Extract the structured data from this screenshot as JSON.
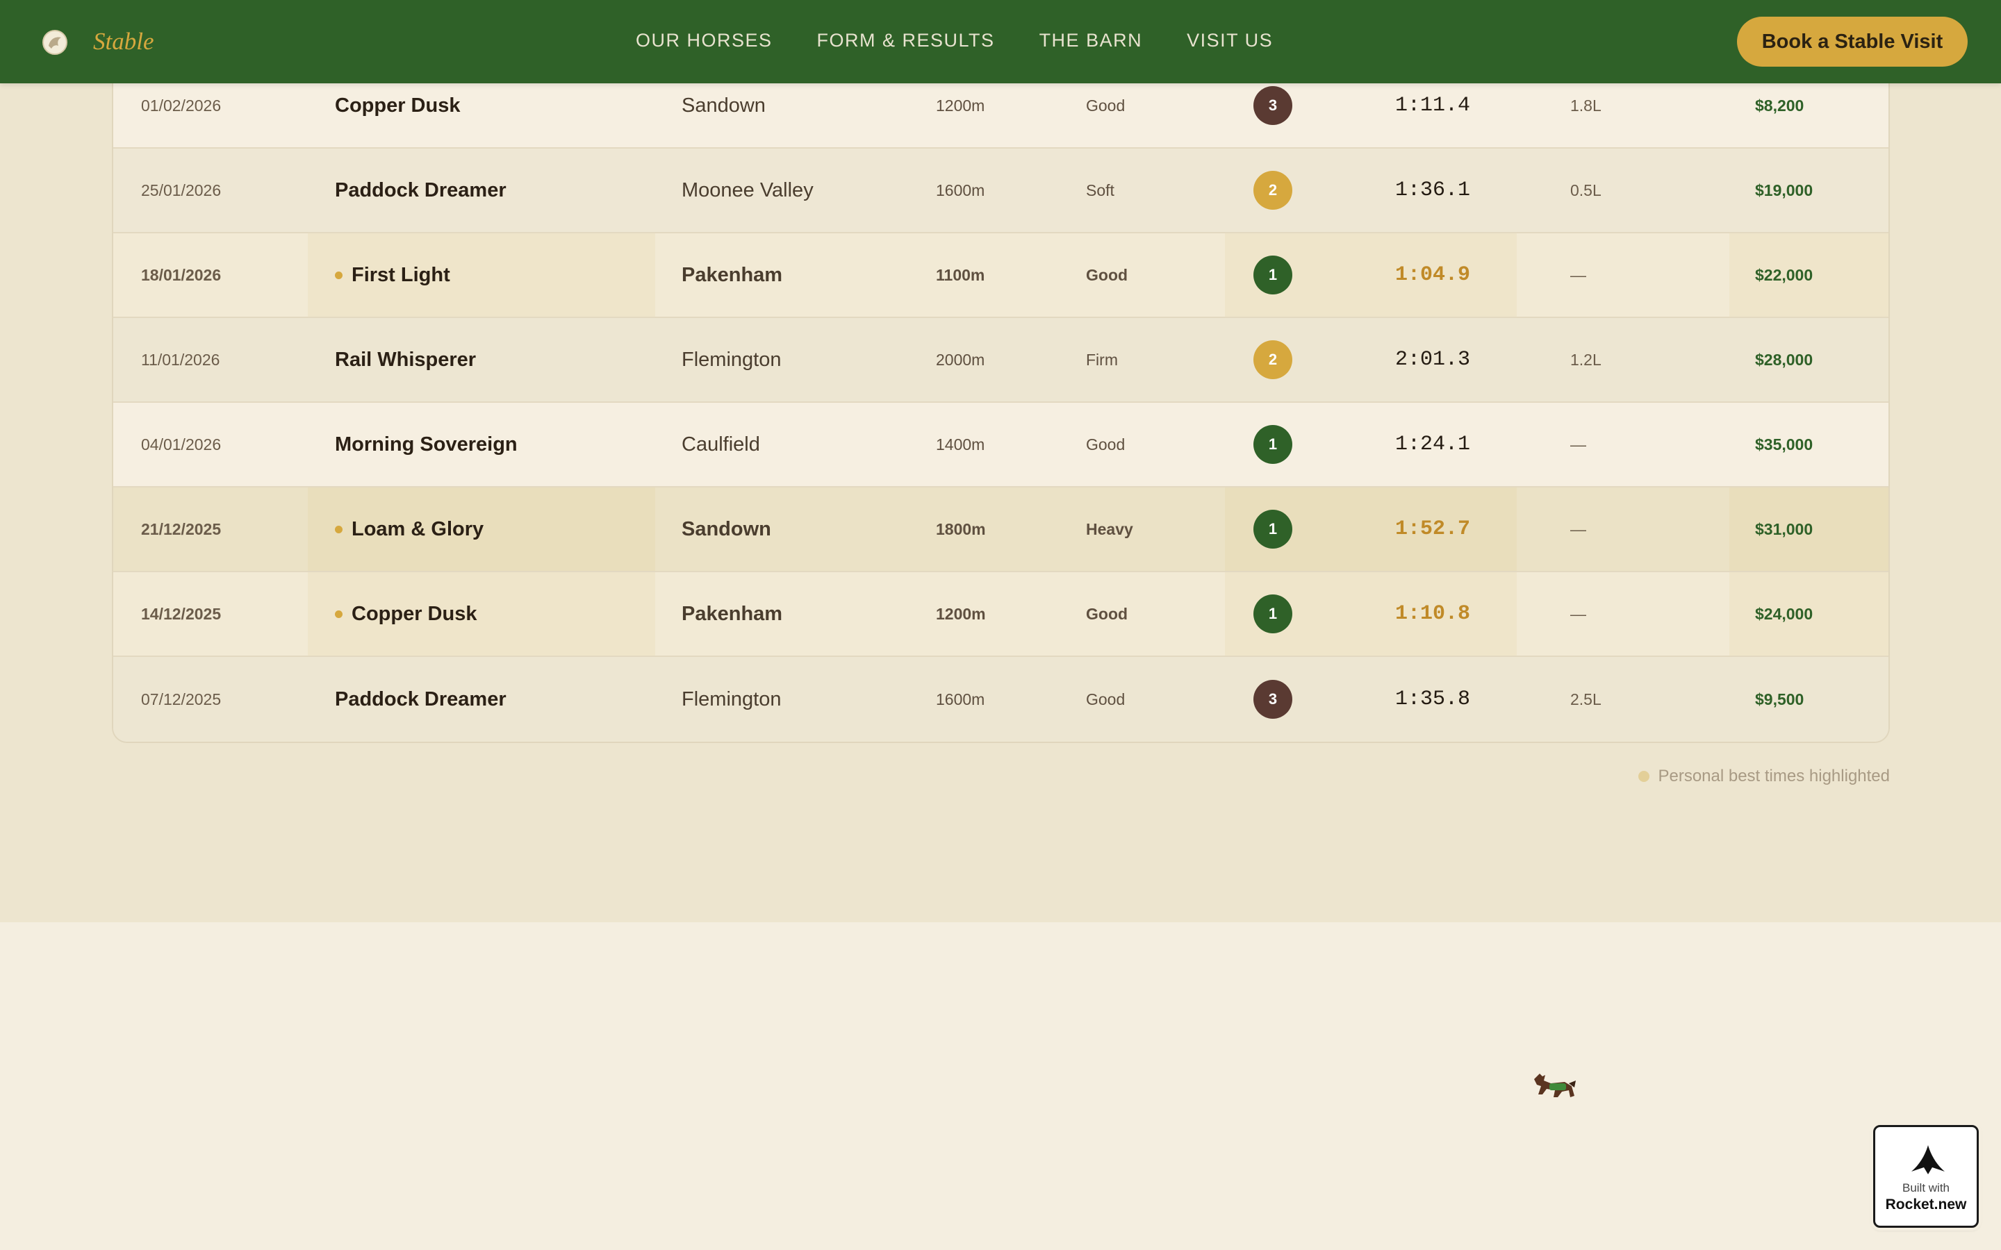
{
  "nav": {
    "brand": "Stable",
    "links": [
      "OUR HORSES",
      "FORM & RESULTS",
      "THE BARN",
      "VISIT US"
    ],
    "cta_label": "Book a Stable Visit"
  },
  "results": [
    {
      "date": "01/02/2026",
      "horse": "Copper Dusk",
      "track": "Sandown",
      "distance": "1200m",
      "going": "Good",
      "position": "3",
      "time": "1:11.4",
      "margin": "1.8L",
      "prize": "$8,200",
      "pb": false
    },
    {
      "date": "25/01/2026",
      "horse": "Paddock Dreamer",
      "track": "Moonee Valley",
      "distance": "1600m",
      "going": "Soft",
      "position": "2",
      "time": "1:36.1",
      "margin": "0.5L",
      "prize": "$19,000",
      "pb": false
    },
    {
      "date": "18/01/2026",
      "horse": "First Light",
      "track": "Pakenham",
      "distance": "1100m",
      "going": "Good",
      "position": "1",
      "time": "1:04.9",
      "margin": "—",
      "prize": "$22,000",
      "pb": true
    },
    {
      "date": "11/01/2026",
      "horse": "Rail Whisperer",
      "track": "Flemington",
      "distance": "2000m",
      "going": "Firm",
      "position": "2",
      "time": "2:01.3",
      "margin": "1.2L",
      "prize": "$28,000",
      "pb": false
    },
    {
      "date": "04/01/2026",
      "horse": "Morning Sovereign",
      "track": "Caulfield",
      "distance": "1400m",
      "going": "Good",
      "position": "1",
      "time": "1:24.1",
      "margin": "—",
      "prize": "$35,000",
      "pb": false
    },
    {
      "date": "21/12/2025",
      "horse": "Loam & Glory",
      "track": "Sandown",
      "distance": "1800m",
      "going": "Heavy",
      "position": "1",
      "time": "1:52.7",
      "margin": "—",
      "prize": "$31,000",
      "pb": true
    },
    {
      "date": "14/12/2025",
      "horse": "Copper Dusk",
      "track": "Pakenham",
      "distance": "1200m",
      "going": "Good",
      "position": "1",
      "time": "1:10.8",
      "margin": "—",
      "prize": "$24,000",
      "pb": true
    },
    {
      "date": "07/12/2025",
      "horse": "Paddock Dreamer",
      "track": "Flemington",
      "distance": "1600m",
      "going": "Good",
      "position": "3",
      "time": "1:35.8",
      "margin": "2.5L",
      "prize": "$9,500",
      "pb": false
    }
  ],
  "position_colors": {
    "1": "#2f6128",
    "2": "#d6a83e",
    "3": "#5a3a32"
  },
  "pb_note": "Personal best times highlighted",
  "rocket_badge": {
    "built_with": "Built with",
    "name": "Rocket.new"
  }
}
